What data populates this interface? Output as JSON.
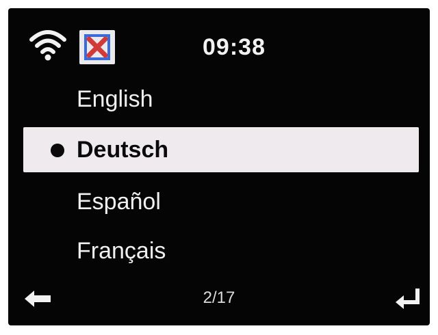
{
  "status_bar": {
    "wifi_icon": "wifi-icon",
    "signal_icon": "no-signal-icon",
    "time": "09:38"
  },
  "language_menu": {
    "items": [
      {
        "label": "English",
        "selected": false
      },
      {
        "label": "Deutsch",
        "selected": true
      },
      {
        "label": "Español",
        "selected": false
      },
      {
        "label": "Français",
        "selected": false
      }
    ]
  },
  "footer": {
    "back_icon": "arrow-left-icon",
    "page_indicator": "2/17",
    "enter_icon": "enter-icon"
  },
  "colors": {
    "screen_background": "#050505",
    "highlight": "#efeaee",
    "text": "#f0f0f0",
    "selected_text": "#0a0a0a",
    "signal_x": "#d23a3a",
    "signal_box_border": "#3a6bd8"
  }
}
